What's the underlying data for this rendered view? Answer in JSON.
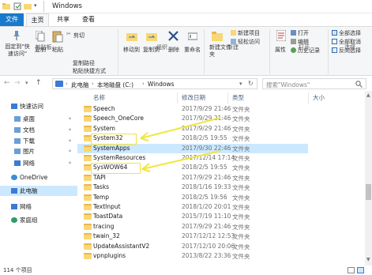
{
  "window": {
    "title": "Windows"
  },
  "tabs": [
    {
      "label": "文件",
      "kind": "file"
    },
    {
      "label": "主页",
      "kind": "active"
    },
    {
      "label": "共享",
      "kind": "normal"
    },
    {
      "label": "查看",
      "kind": "normal"
    }
  ],
  "ribbon": {
    "clipboard": {
      "pin_label": "固定到\"快速访问\"",
      "copy_label": "复制",
      "paste_label": "粘贴",
      "cut_label": "剪切",
      "copy_path_label": "复制路径",
      "paste_shortcut_label": "粘贴快捷方式",
      "group_label": "剪贴板"
    },
    "organize": {
      "move_to_label": "移动到",
      "copy_to_label": "复制到",
      "delete_label": "删除",
      "rename_label": "重命名",
      "group_label": "组织"
    },
    "new": {
      "new_folder_label": "新建文件夹",
      "new_item_label": "新建项目",
      "easy_access_label": "轻松访问",
      "group_label": "新建"
    },
    "open": {
      "properties_label": "属性",
      "open_label": "打开",
      "edit_label": "编辑",
      "history_label": "历史记录",
      "group_label": "打开"
    },
    "select": {
      "select_all_label": "全部选择",
      "select_none_label": "全部取消",
      "invert_label": "反向选择",
      "group_label": "选择"
    }
  },
  "address": {
    "segments": [
      "此电脑",
      "本地磁盘 (C:)",
      "Windows"
    ],
    "search_placeholder": "搜索\"Windows\""
  },
  "nav": {
    "items": [
      {
        "label": "快速访问",
        "icon": "star-icon",
        "level": 0,
        "selected": false
      },
      {
        "label": "桌面",
        "icon": "desktop-icon",
        "level": 1,
        "selected": false
      },
      {
        "label": "文档",
        "icon": "document-icon",
        "level": 1,
        "selected": false
      },
      {
        "label": "下载",
        "icon": "download-icon",
        "level": 1,
        "selected": false
      },
      {
        "label": "图片",
        "icon": "picture-icon",
        "level": 1,
        "selected": false
      },
      {
        "label": "网络",
        "icon": "network-icon",
        "level": 1,
        "selected": false
      },
      {
        "label": "OneDrive",
        "icon": "cloud-icon",
        "level": 0,
        "selected": false
      },
      {
        "label": "此电脑",
        "icon": "computer-icon",
        "level": 0,
        "selected": true
      },
      {
        "label": "网络",
        "icon": "network-icon",
        "level": 0,
        "selected": false
      },
      {
        "label": "家庭组",
        "icon": "homegroup-icon",
        "level": 0,
        "selected": false
      }
    ]
  },
  "columns": {
    "name": "名称",
    "date": "修改日期",
    "type": "类型",
    "size": "大小"
  },
  "files": [
    {
      "name": "Speech",
      "date": "2017/9/29 21:46",
      "type": "文件夹",
      "selected": false
    },
    {
      "name": "Speech_OneCore",
      "date": "2017/9/29 21:46",
      "type": "文件夹",
      "selected": false
    },
    {
      "name": "System",
      "date": "2017/9/29 21:46",
      "type": "文件夹",
      "selected": false
    },
    {
      "name": "System32",
      "date": "2018/2/5 19:55",
      "type": "文件夹",
      "selected": false
    },
    {
      "name": "SystemApps",
      "date": "2017/9/30 22:46",
      "type": "文件夹",
      "selected": true
    },
    {
      "name": "SystemResources",
      "date": "2017/12/14 17:14",
      "type": "文件夹",
      "selected": false
    },
    {
      "name": "SysWOW64",
      "date": "2018/2/5 19:55",
      "type": "文件夹",
      "selected": false
    },
    {
      "name": "TAPI",
      "date": "2017/9/29 21:46",
      "type": "文件夹",
      "selected": false
    },
    {
      "name": "Tasks",
      "date": "2018/1/16 19:33",
      "type": "文件夹",
      "selected": false
    },
    {
      "name": "Temp",
      "date": "2018/2/5 19:56",
      "type": "文件夹",
      "selected": false
    },
    {
      "name": "TextInput",
      "date": "2018/1/20 20:01",
      "type": "文件夹",
      "selected": false
    },
    {
      "name": "ToastData",
      "date": "2015/7/19 11:10",
      "type": "文件夹",
      "selected": false
    },
    {
      "name": "tracing",
      "date": "2017/9/29 21:46",
      "type": "文件夹",
      "selected": false
    },
    {
      "name": "twain_32",
      "date": "2017/12/12 12:53",
      "type": "文件夹",
      "selected": false
    },
    {
      "name": "UpdateAssistantV2",
      "date": "2017/12/10 20:06",
      "type": "文件夹",
      "selected": false
    },
    {
      "name": "vpnplugins",
      "date": "2013/8/22 23:36",
      "type": "文件夹",
      "selected": false
    }
  ],
  "status": {
    "count_label": "114 个项目"
  },
  "colors": {
    "accent": "#1979ca",
    "selection": "#cce8ff",
    "highlight": "#f5e23a",
    "folder": "#f8d775"
  }
}
